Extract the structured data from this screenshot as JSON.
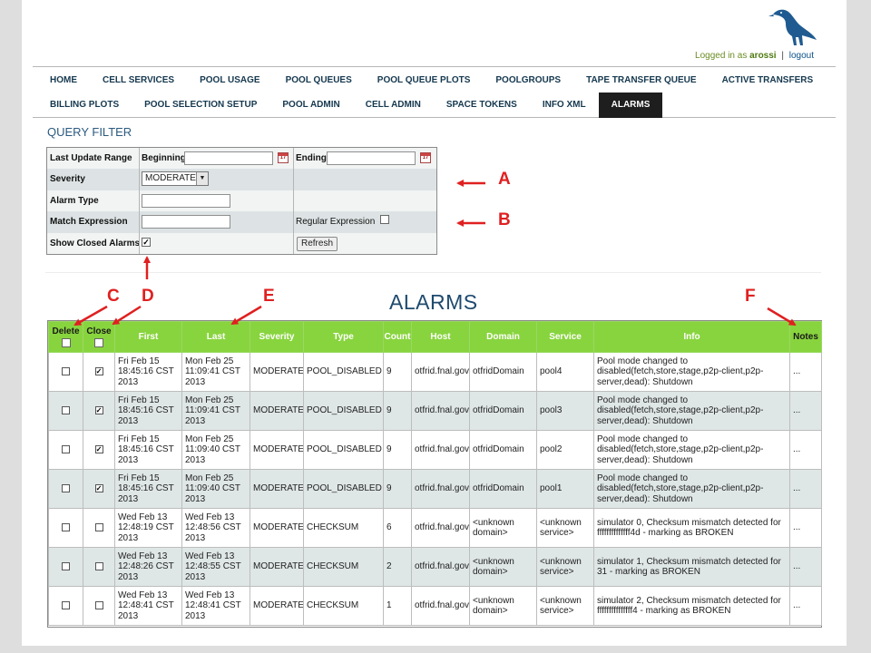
{
  "header": {
    "logged_in_prefix": "Logged in as",
    "username": "arossi",
    "separator": "|",
    "logout_label": "logout"
  },
  "nav": {
    "row1": [
      "HOME",
      "CELL SERVICES",
      "POOL USAGE",
      "POOL QUEUES",
      "POOL QUEUE PLOTS",
      "POOLGROUPS",
      "TAPE TRANSFER QUEUE",
      "ACTIVE TRANSFERS"
    ],
    "row2": [
      "BILLING PLOTS",
      "POOL SELECTION SETUP",
      "POOL ADMIN",
      "CELL ADMIN",
      "SPACE TOKENS",
      "INFO XML",
      "ALARMS"
    ],
    "active": "ALARMS"
  },
  "query_filter": {
    "title": "QUERY FILTER",
    "last_update_range_label": "Last Update Range",
    "beginning_label": "Beginning",
    "ending_label": "Ending",
    "calendar_glyph": "17",
    "severity_label": "Severity",
    "severity_value": "MODERATE",
    "alarm_type_label": "Alarm Type",
    "match_expression_label": "Match Expression",
    "regular_expression_label": "Regular Expression",
    "regular_expression_checked": false,
    "show_closed_label": "Show Closed Alarms",
    "show_closed_checked": true,
    "refresh_label": "Refresh"
  },
  "annotations": [
    "A",
    "B",
    "C",
    "D",
    "E",
    "F"
  ],
  "alarms": {
    "title": "ALARMS",
    "columns": [
      "Delete",
      "Close",
      "First",
      "Last",
      "Severity",
      "Type",
      "Count",
      "Host",
      "Domain",
      "Service",
      "Info",
      "Notes"
    ],
    "rows": [
      {
        "close": true,
        "first": "Fri Feb 15 18:45:16 CST 2013",
        "last": "Mon Feb 25 11:09:41 CST 2013",
        "severity": "MODERATE",
        "type": "POOL_DISABLED",
        "count": "9",
        "host": "otfrid.fnal.gov",
        "domain": "otfridDomain",
        "service": "pool4",
        "info": "Pool mode changed to disabled(fetch,store,stage,p2p-client,p2p-server,dead): Shutdown",
        "notes": "..."
      },
      {
        "close": true,
        "first": "Fri Feb 15 18:45:16 CST 2013",
        "last": "Mon Feb 25 11:09:41 CST 2013",
        "severity": "MODERATE",
        "type": "POOL_DISABLED",
        "count": "9",
        "host": "otfrid.fnal.gov",
        "domain": "otfridDomain",
        "service": "pool3",
        "info": "Pool mode changed to disabled(fetch,store,stage,p2p-client,p2p-server,dead): Shutdown",
        "notes": "..."
      },
      {
        "close": true,
        "first": "Fri Feb 15 18:45:16 CST 2013",
        "last": "Mon Feb 25 11:09:40 CST 2013",
        "severity": "MODERATE",
        "type": "POOL_DISABLED",
        "count": "9",
        "host": "otfrid.fnal.gov",
        "domain": "otfridDomain",
        "service": "pool2",
        "info": "Pool mode changed to disabled(fetch,store,stage,p2p-client,p2p-server,dead): Shutdown",
        "notes": "..."
      },
      {
        "close": true,
        "first": "Fri Feb 15 18:45:16 CST 2013",
        "last": "Mon Feb 25 11:09:40 CST 2013",
        "severity": "MODERATE",
        "type": "POOL_DISABLED",
        "count": "9",
        "host": "otfrid.fnal.gov",
        "domain": "otfridDomain",
        "service": "pool1",
        "info": "Pool mode changed to disabled(fetch,store,stage,p2p-client,p2p-server,dead): Shutdown",
        "notes": "..."
      },
      {
        "close": false,
        "first": "Wed Feb 13 12:48:19 CST 2013",
        "last": "Wed Feb 13 12:48:56 CST 2013",
        "severity": "MODERATE",
        "type": "CHECKSUM",
        "count": "6",
        "host": "otfrid.fnal.gov",
        "domain": "<unknown domain>",
        "service": "<unknown service>",
        "info": "simulator 0, Checksum mismatch detected for ffffffffffffff4d - marking as BROKEN",
        "notes": "..."
      },
      {
        "close": false,
        "first": "Wed Feb 13 12:48:26 CST 2013",
        "last": "Wed Feb 13 12:48:55 CST 2013",
        "severity": "MODERATE",
        "type": "CHECKSUM",
        "count": "2",
        "host": "otfrid.fnal.gov",
        "domain": "<unknown domain>",
        "service": "<unknown service>",
        "info": "simulator 1, Checksum mismatch detected for 31 - marking as BROKEN",
        "notes": "..."
      },
      {
        "close": false,
        "first": "Wed Feb 13 12:48:41 CST 2013",
        "last": "Wed Feb 13 12:48:41 CST 2013",
        "severity": "MODERATE",
        "type": "CHECKSUM",
        "count": "1",
        "host": "otfrid.fnal.gov",
        "domain": "<unknown domain>",
        "service": "<unknown service>",
        "info": "simulator 2, Checksum mismatch detected for fffffffffffffff4 - marking as BROKEN",
        "notes": "..."
      }
    ]
  },
  "colors": {
    "header_green": "#88d43e",
    "row_alt": "#dfe6e6",
    "annotation_red": "#e02020",
    "title_blue": "#1e4a6e"
  }
}
